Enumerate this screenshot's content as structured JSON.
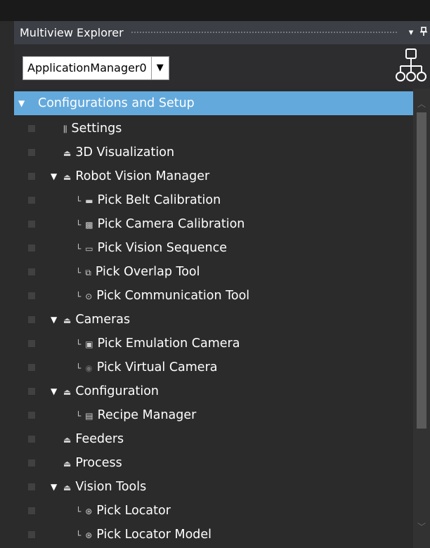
{
  "panel": {
    "title": "Multiview Explorer",
    "pin_glyph": "▾",
    "close_glyph": "⑂"
  },
  "toolbar": {
    "app_selector_value": "ApplicationManager0",
    "app_selector_arrow": "▼",
    "hierarchy_icon": "hierarchy-icon"
  },
  "tree": {
    "items": [
      {
        "label": "Configurations and Setup",
        "icon": "expand-arrow",
        "selected": true
      },
      {
        "label": "Settings",
        "icon": "settings-icon"
      },
      {
        "label": "3D Visualization",
        "icon": "folder-icon"
      },
      {
        "label": "Robot Vision Manager",
        "icon": "folder-icon"
      },
      {
        "label": "Pick Belt Calibration",
        "icon": "belt-calibration-icon"
      },
      {
        "label": "Pick Camera Calibration",
        "icon": "camera-calibration-icon"
      },
      {
        "label": "Pick Vision Sequence",
        "icon": "vision-sequence-icon"
      },
      {
        "label": "Pick Overlap Tool",
        "icon": "overlap-tool-icon"
      },
      {
        "label": "Pick Communication Tool",
        "icon": "communication-tool-icon"
      },
      {
        "label": "Cameras",
        "icon": "folder-icon"
      },
      {
        "label": "Pick Emulation Camera",
        "icon": "emulation-camera-icon"
      },
      {
        "label": "Pick Virtual Camera",
        "icon": "virtual-camera-icon"
      },
      {
        "label": "Configuration",
        "icon": "folder-icon"
      },
      {
        "label": "Recipe Manager",
        "icon": "recipe-manager-icon"
      },
      {
        "label": "Feeders",
        "icon": "folder-icon"
      },
      {
        "label": "Process",
        "icon": "folder-icon"
      },
      {
        "label": "Vision Tools",
        "icon": "folder-icon"
      },
      {
        "label": "Pick Locator",
        "icon": "locator-icon"
      },
      {
        "label": "Pick Locator Model",
        "icon": "locator-model-icon"
      }
    ]
  },
  "colors": {
    "selection": "#64a9dc",
    "panel_bg": "#2b2b2b",
    "title_bg": "#3c3f45"
  }
}
